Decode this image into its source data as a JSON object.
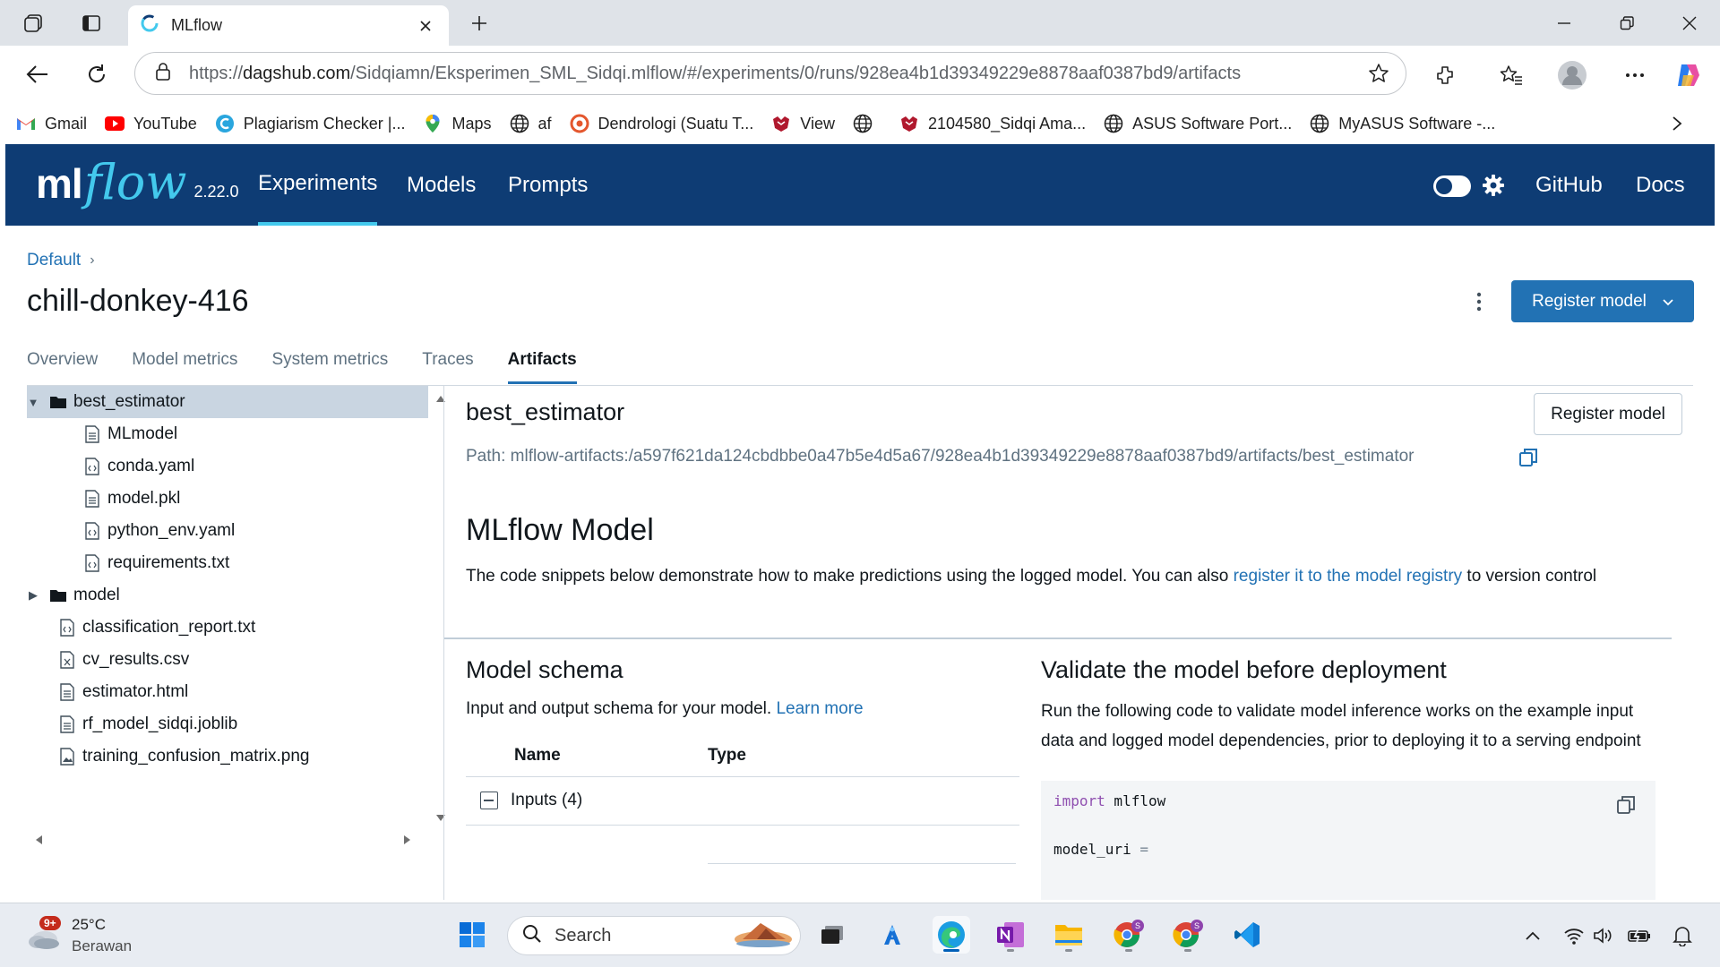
{
  "browser": {
    "tab_title": "MLflow",
    "url_prefix": "https://",
    "url_host": "dagshub.com",
    "url_path": "/Sidqiamn/Eksperimen_SML_Sidqi.mlflow/#/experiments/0/runs/928ea4b1d39349229e8878aaf0387bd9/artifacts",
    "bookmarks": [
      {
        "label": "Gmail",
        "icon": "gmail-icon"
      },
      {
        "label": "YouTube",
        "icon": "youtube-icon"
      },
      {
        "label": "Plagiarism Checker |...",
        "icon": "plagiarism-icon"
      },
      {
        "label": "Maps",
        "icon": "maps-icon"
      },
      {
        "label": "af",
        "icon": "globe-icon"
      },
      {
        "label": "Dendrologi (Suatu T...",
        "icon": "dendrologi-icon"
      },
      {
        "label": "View",
        "icon": "ipb-icon"
      },
      {
        "label": "",
        "icon": "globe-icon"
      },
      {
        "label": "2104580_Sidqi Ama...",
        "icon": "ipb-icon"
      },
      {
        "label": "ASUS Software Port...",
        "icon": "globe-icon"
      },
      {
        "label": "MyASUS Software -...",
        "icon": "globe-icon"
      }
    ]
  },
  "mlflow": {
    "logo_ml": "ml",
    "logo_flow": "flow",
    "version": "2.22.0",
    "nav": {
      "experiments": "Experiments",
      "models": "Models",
      "prompts": "Prompts",
      "github": "GitHub",
      "docs": "Docs"
    },
    "breadcrumb": "Default",
    "run_name": "chill-donkey-416",
    "register_model": "Register model",
    "tabs": [
      "Overview",
      "Model metrics",
      "System metrics",
      "Traces",
      "Artifacts"
    ],
    "tree": [
      {
        "label": "best_estimator",
        "type": "folder",
        "expanded": true,
        "level": 0
      },
      {
        "label": "MLmodel",
        "type": "file",
        "level": 1
      },
      {
        "label": "conda.yaml",
        "type": "code",
        "level": 1
      },
      {
        "label": "model.pkl",
        "type": "file",
        "level": 1
      },
      {
        "label": "python_env.yaml",
        "type": "code",
        "level": 1
      },
      {
        "label": "requirements.txt",
        "type": "code",
        "level": 1
      },
      {
        "label": "model",
        "type": "folder",
        "expanded": false,
        "level": 0
      },
      {
        "label": "classification_report.txt",
        "type": "code",
        "level": 0
      },
      {
        "label": "cv_results.csv",
        "type": "csv",
        "level": 0
      },
      {
        "label": "estimator.html",
        "type": "file",
        "level": 0
      },
      {
        "label": "rf_model_sidqi.joblib",
        "type": "file",
        "level": 0
      },
      {
        "label": "training_confusion_matrix.png",
        "type": "image",
        "level": 0
      }
    ],
    "artifact": {
      "title": "best_estimator",
      "path": "Path: mlflow-artifacts:/a597f621da124cbdbbe0a47b5e4d5a67/928ea4b1d39349229e8878aaf0387bd9/artifacts/best_estimator",
      "register_button": "Register model",
      "model_heading": "MLflow Model",
      "desc_before": "The code snippets below demonstrate how to make predictions using the logged model. You can also ",
      "desc_link": "register it to the model registry",
      "desc_after": " to version control",
      "schema_title": "Model schema",
      "schema_desc": "Input and output schema for your model. ",
      "schema_link": "Learn more",
      "col_name": "Name",
      "col_type": "Type",
      "inputs_label": "Inputs (4)",
      "validate_title": "Validate the model before deployment",
      "validate_desc": "Run the following code to validate model inference works on the example input data and logged model dependencies, prior to deploying it to a serving endpoint",
      "code_kw": "import",
      "code_mod": " mlflow",
      "code_var": "model_uri",
      "code_op": " ="
    }
  },
  "taskbar": {
    "weather_badge": "9+",
    "temperature": "25°C",
    "condition": "Berawan",
    "search_placeholder": "Search"
  }
}
